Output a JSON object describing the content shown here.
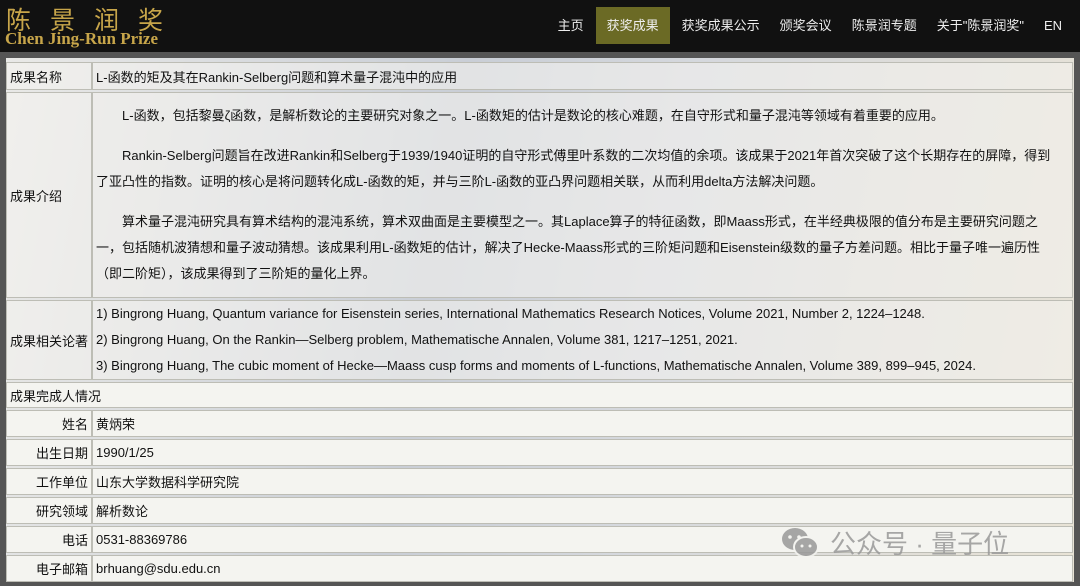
{
  "header": {
    "logo_cn": "陈景润奖",
    "logo_en": "Chen Jing-Run Prize",
    "nav": [
      "主页",
      "获奖成果",
      "获奖成果公示",
      "颁奖会议",
      "陈景润专题",
      "关于\"陈景润奖\"",
      "EN"
    ],
    "active_index": 1
  },
  "result": {
    "title_label": "成果名称",
    "title": "L-函数的矩及其在Rankin-Selberg问题和算术量子混沌中的应用",
    "intro_label": "成果介绍",
    "intro": [
      "L-函数，包括黎曼ζ函数，是解析数论的主要研究对象之一。L-函数矩的估计是数论的核心难题，在自守形式和量子混沌等领域有着重要的应用。",
      "Rankin-Selberg问题旨在改进Rankin和Selberg于1939/1940证明的自守形式傅里叶系数的二次均值的余项。该成果于2021年首次突破了这个长期存在的屏障，得到了亚凸性的指数。证明的核心是将问题转化成L-函数的矩，并与三阶L-函数的亚凸界问题相关联，从而利用delta方法解决问题。",
      "算术量子混沌研究具有算术结构的混沌系统，算术双曲面是主要模型之一。其Laplace算子的特征函数，即Maass形式，在半经典极限的值分布是主要研究问题之一，包括随机波猜想和量子波动猜想。该成果利用L-函数矩的估计，解决了Hecke-Maass形式的三阶矩问题和Eisenstein级数的量子方差问题。相比于量子唯一遍历性（即二阶矩），该成果得到了三阶矩的量化上界。"
    ],
    "papers_label": "成果相关论著",
    "papers": [
      "1) Bingrong Huang, Quantum variance for Eisenstein series, International Mathematics Research Notices, Volume 2021, Number 2, 1224–1248.",
      "2) Bingrong Huang, On the Rankin—Selberg problem, Mathematische Annalen, Volume 381, 1217–1251, 2021.",
      "3) Bingrong Huang, The cubic moment of Hecke—Maass cusp forms and moments of L-functions, Mathematische Annalen, Volume 389, 899–945, 2024."
    ]
  },
  "person": {
    "section_label": "成果完成人情况",
    "rows": [
      {
        "label": "姓名",
        "value": "黄炳荣"
      },
      {
        "label": "出生日期",
        "value": "1990/1/25"
      },
      {
        "label": "工作单位",
        "value": "山东大学数据科学研究院"
      },
      {
        "label": "研究领域",
        "value": "解析数论"
      },
      {
        "label": "电话",
        "value": "0531-88369786"
      },
      {
        "label": "电子邮箱",
        "value": "brhuang@sdu.edu.cn"
      }
    ]
  },
  "watermark": "公众号 · 量子位"
}
